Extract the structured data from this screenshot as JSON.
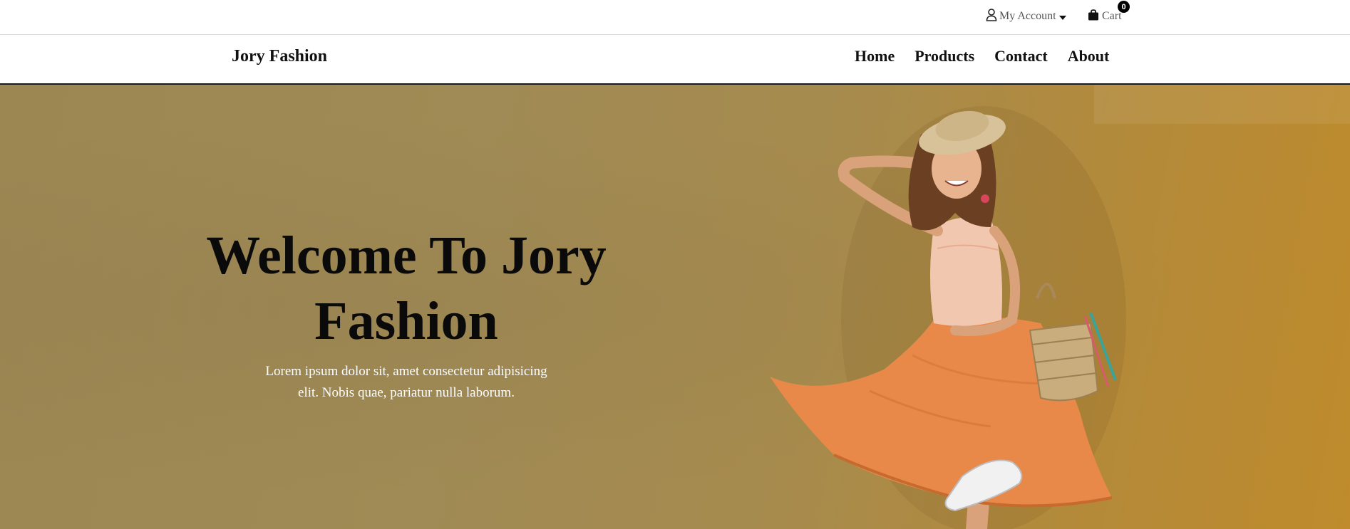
{
  "topbar": {
    "account_label": "My Account",
    "cart_label": "Cart",
    "cart_count": "0",
    "icons": {
      "account": "user-icon",
      "dropdown": "caret-down-icon",
      "cart": "shopping-bag-icon"
    }
  },
  "nav": {
    "brand": "Jory Fashion",
    "links": [
      "Home",
      "Products",
      "Contact",
      "About"
    ]
  },
  "hero": {
    "title_line1": "Welcome To Jory",
    "title_line2": "Fashion",
    "text_line1": "Lorem ipsum dolor sit, amet consectetur adipisicing",
    "text_line2": "elit. Nobis quae, pariatur nulla laborum.",
    "image": "smiling-woman-in-orange-dress-with-straw-hat-and-basket",
    "background_color": "#a08a55",
    "accent_dress_color": "#e8894a"
  }
}
